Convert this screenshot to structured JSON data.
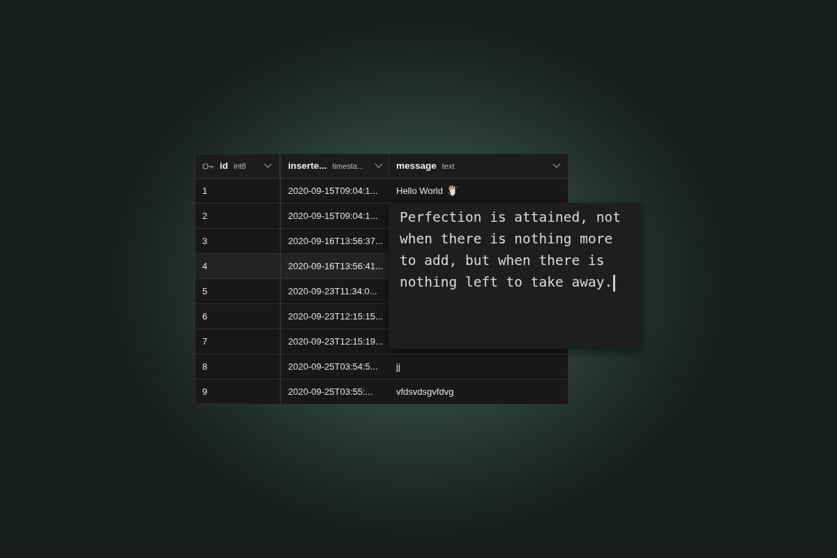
{
  "table": {
    "columns": [
      {
        "name": "id",
        "type": "int8",
        "kind": "key"
      },
      {
        "name": "inserte...",
        "type": "timesta...",
        "kind": "plain"
      },
      {
        "name": "message",
        "type": "text",
        "kind": "plain"
      }
    ],
    "rows": [
      {
        "id": "1",
        "inserted": "2020-09-15T09:04:1...",
        "message": "Hello World",
        "selected": false
      },
      {
        "id": "2",
        "inserted": "2020-09-15T09:04:1...",
        "selected": false
      },
      {
        "id": "3",
        "inserted": "2020-09-16T13:56:37...",
        "selected": false
      },
      {
        "id": "4",
        "inserted": "2020-09-16T13:56:41...",
        "selected": true
      },
      {
        "id": "5",
        "inserted": "2020-09-23T11:34:0...",
        "selected": false
      },
      {
        "id": "6",
        "inserted": "2020-09-23T12:15:15...",
        "selected": false
      },
      {
        "id": "7",
        "inserted": "2020-09-23T12:15:19...",
        "selected": false
      },
      {
        "id": "8",
        "inserted": "2020-09-25T03:54:5...",
        "message": "jj",
        "selected": false
      },
      {
        "id": "9",
        "inserted": "2020-09-25T03:55:...",
        "message": "vfdsvdsgvfdvg",
        "selected": false
      }
    ]
  },
  "editor": {
    "value": "Perfection is attained, not when there is nothing more to add, but when there is nothing left to take away."
  }
}
